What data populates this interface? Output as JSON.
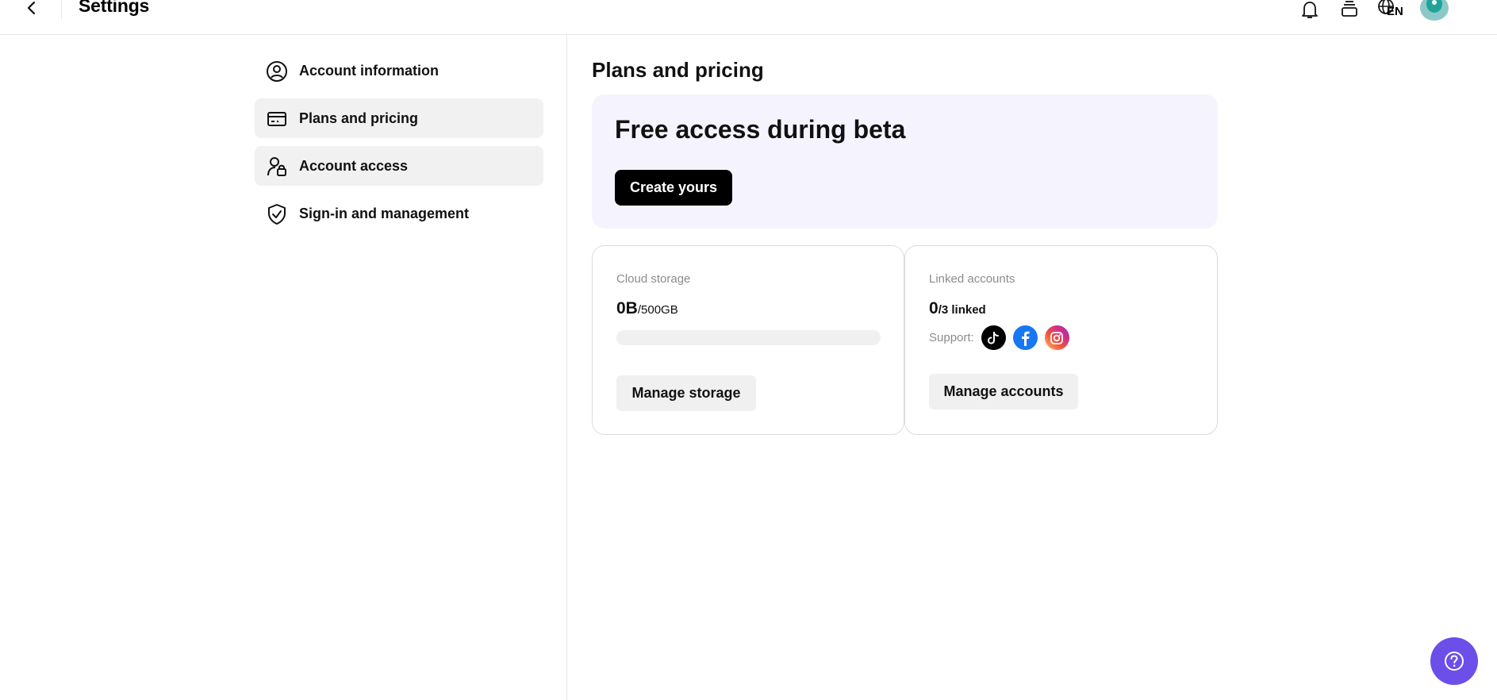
{
  "header": {
    "title": "Settings",
    "language": "EN",
    "icons": [
      "back-arrow-icon",
      "bell-icon",
      "layers-icon",
      "globe-icon",
      "avatar"
    ]
  },
  "sidebar": {
    "items": [
      {
        "label": "Account information",
        "icon": "user-circle-icon",
        "active": false
      },
      {
        "label": "Plans and pricing",
        "icon": "credit-card-icon",
        "active": true
      },
      {
        "label": "Account access",
        "icon": "user-lock-icon",
        "active": true
      },
      {
        "label": "Sign-in and management",
        "icon": "shield-check-icon",
        "active": false
      }
    ]
  },
  "main": {
    "section_title": "Plans and pricing",
    "beta": {
      "title": "Free access during beta",
      "button_label": "Create yours"
    },
    "storage": {
      "label": "Cloud storage",
      "used": "0B",
      "total": "/500GB",
      "used_fraction": 0,
      "button_label": "Manage storage"
    },
    "linked": {
      "label": "Linked accounts",
      "count": "0",
      "total": "/3 linked",
      "support_label": "Support:",
      "platforms": [
        "tiktok-icon",
        "facebook-icon",
        "instagram-icon"
      ],
      "button_label": "Manage accounts"
    }
  },
  "colors": {
    "accent": "#6c4ee8",
    "beta_card_bg": "#f5f4fe",
    "active_nav_bg": "#f1f1f1",
    "facebook": "#1877f2"
  }
}
